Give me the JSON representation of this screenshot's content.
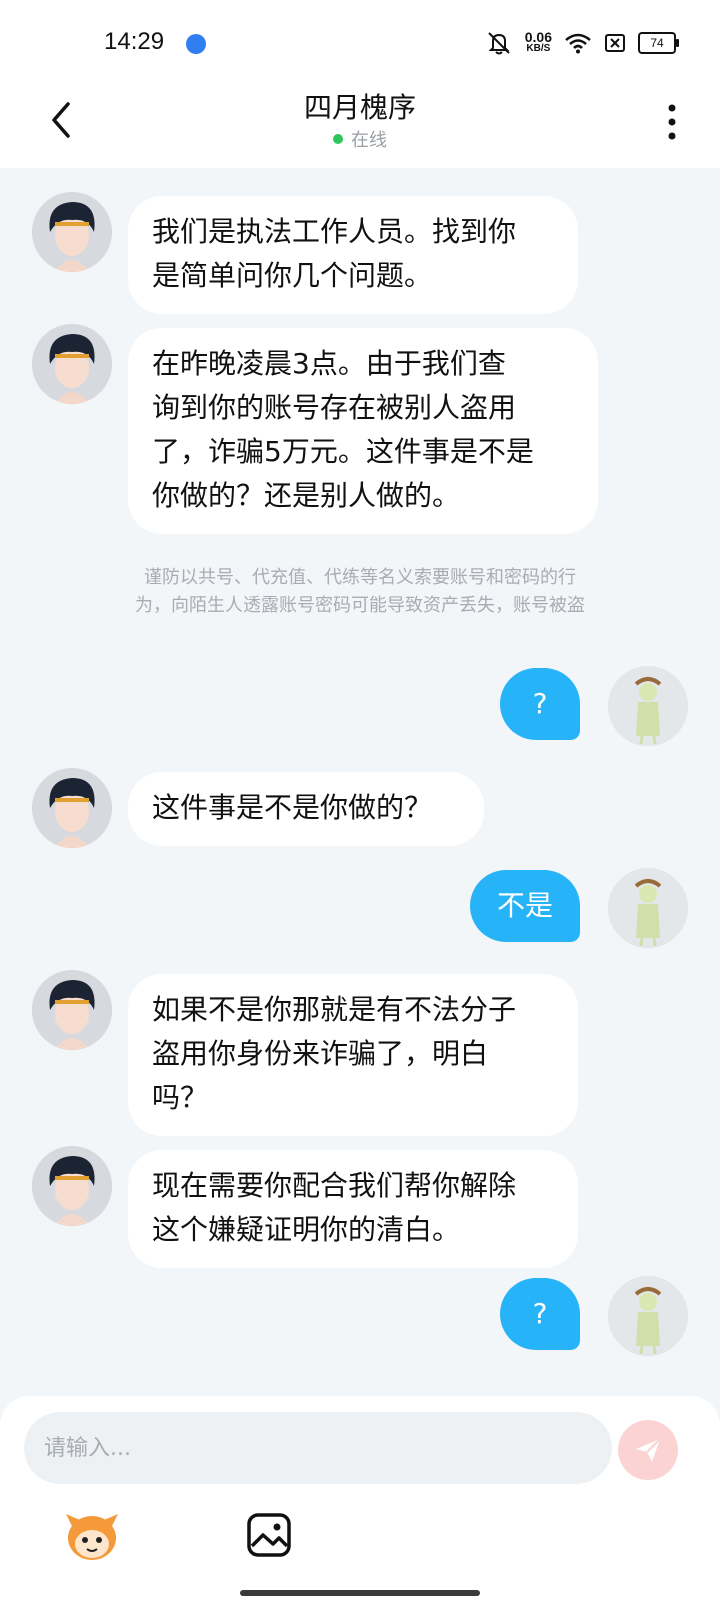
{
  "status_bar": {
    "time": "14:29",
    "net_speed_value": "0.06",
    "net_speed_unit": "KB/S",
    "battery": "74"
  },
  "header": {
    "title": "四月槐序",
    "status": "在线"
  },
  "messages": [
    {
      "side": "left",
      "text_lines": [
        "我们是执法工作人员。找到你",
        "是简单问你几个问题。"
      ]
    },
    {
      "side": "left",
      "text_lines": [
        "在昨晚凌晨3点。由于我们查",
        "询到你的账号存在被别人盗用",
        "了，诈骗5万元。这件事是不是",
        "你做的？还是别人做的。"
      ]
    },
    {
      "side": "notice",
      "text_lines": [
        "谨防以共号、代充值、代练等名义索要账号和密码的行",
        "为，向陌生人透露账号密码可能导致资产丢失，账号被盗"
      ]
    },
    {
      "side": "right",
      "text": "?"
    },
    {
      "side": "left",
      "text_lines": [
        "这件事是不是你做的？"
      ]
    },
    {
      "side": "right",
      "text": "不是"
    },
    {
      "side": "left",
      "text_lines": [
        "如果不是你那就是有不法分子",
        "盗用你身份来诈骗了，明白",
        "吗？"
      ]
    },
    {
      "side": "left",
      "text_lines": [
        "现在需要你配合我们帮你解除",
        "这个嫌疑证明你的清白。"
      ]
    },
    {
      "side": "right",
      "text": "?"
    }
  ],
  "composer": {
    "placeholder": "请输入..."
  },
  "colors": {
    "accent": "#27b3f7",
    "online": "#2ec65c",
    "background": "#f3f6f9",
    "send_button": "#fbd3d3"
  },
  "icons": {
    "back": "chevron-left-icon",
    "more": "more-vertical-icon",
    "send": "send-icon",
    "image": "image-icon",
    "mascot": "mascot-icon"
  }
}
